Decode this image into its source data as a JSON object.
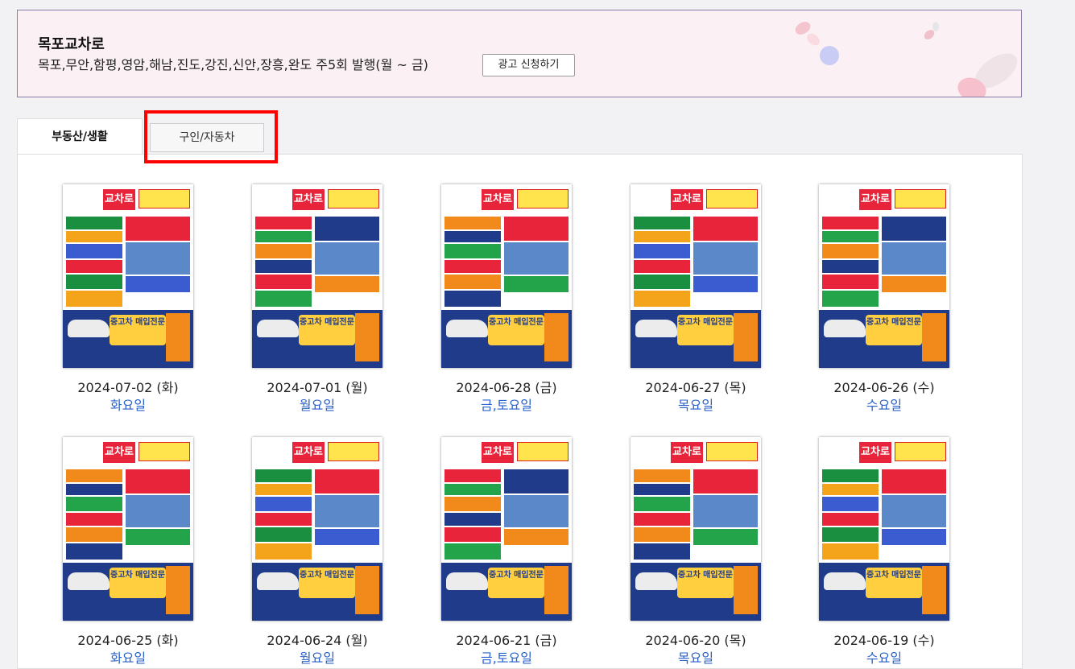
{
  "header": {
    "title": "목포교차로",
    "subtitle": "목포,무안,함평,영암,해남,진도,강진,신안,장흥,완도 주5회 발행(월 ~ 금)",
    "apply_button": "광고 신청하기"
  },
  "tabs": [
    {
      "label": "부동산/생활",
      "active": true
    },
    {
      "label": "구인/자동차",
      "active": false
    }
  ],
  "thumbnail_logo_text": "교차로",
  "thumbnail_banner_text": "중고차 매입전문",
  "papers": [
    {
      "date": "2024-07-02 (화)",
      "day_label": "화요일"
    },
    {
      "date": "2024-07-01 (월)",
      "day_label": "월요일"
    },
    {
      "date": "2024-06-28 (금)",
      "day_label": "금,토요일"
    },
    {
      "date": "2024-06-27 (목)",
      "day_label": "목요일"
    },
    {
      "date": "2024-06-26 (수)",
      "day_label": "수요일"
    },
    {
      "date": "2024-06-25 (화)",
      "day_label": "화요일"
    },
    {
      "date": "2024-06-24 (월)",
      "day_label": "월요일"
    },
    {
      "date": "2024-06-21 (금)",
      "day_label": "금,토요일"
    },
    {
      "date": "2024-06-20 (목)",
      "day_label": "목요일"
    },
    {
      "date": "2024-06-19 (수)",
      "day_label": "수요일"
    }
  ],
  "colors": {
    "header_bg": "#fbf1f4",
    "link_blue": "#2a62c9",
    "highlight_red": "#ff0000",
    "logo_red": "#e8243a",
    "banner_navy": "#1f3b8a"
  }
}
